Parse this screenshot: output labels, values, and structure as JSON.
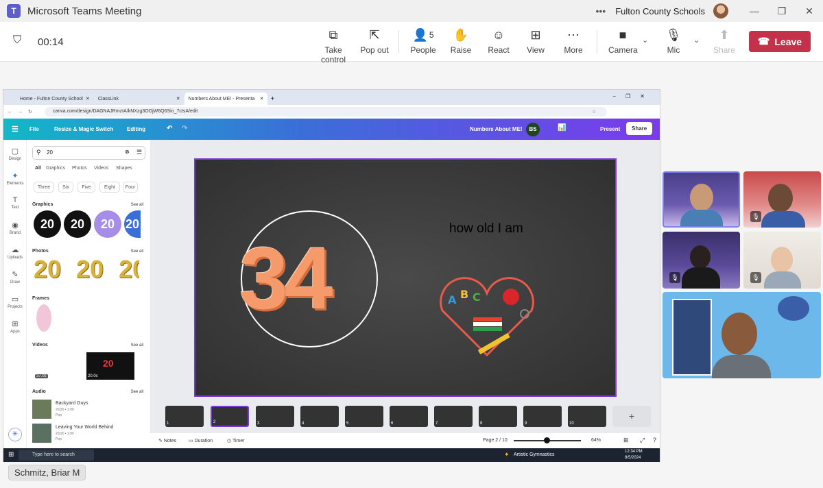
{
  "app": {
    "title": "Microsoft Teams Meeting",
    "org": "Fulton County Schools"
  },
  "meeting": {
    "timer": "00:14",
    "people_count": "5"
  },
  "toolbar": {
    "take_control": "Take control",
    "pop_out": "Pop out",
    "people": "People",
    "raise": "Raise",
    "react": "React",
    "view": "View",
    "more": "More",
    "camera": "Camera",
    "mic": "Mic",
    "share": "Share",
    "leave": "Leave"
  },
  "browser": {
    "tabs": [
      "Home - Fulton County School",
      "ClassLink",
      "Numbers About ME! - Presenta"
    ],
    "url": "canva.com/design/DAGNAJRmztA/kNXzg3OOjW6Q6Sio_7ctsA/edit"
  },
  "canva": {
    "file": "File",
    "resize": "Resize & Magic Switch",
    "editing": "Editing",
    "design_title": "Numbers About ME!",
    "avatar_initials": "BS",
    "present": "Present",
    "share": "Share",
    "rail": [
      "Design",
      "Elements",
      "Text",
      "Brand",
      "Uploads",
      "Draw",
      "Projects",
      "Apps"
    ],
    "search_value": "20",
    "panel_tabs": [
      "All",
      "Graphics",
      "Photos",
      "Videos",
      "Shapes"
    ],
    "pills": [
      "Three",
      "Six",
      "Five",
      "Eight",
      "Four"
    ],
    "sections": {
      "graphics": "Graphics",
      "photos": "Photos",
      "frames": "Frames",
      "videos": "Videos",
      "audio": "Audio"
    },
    "see_all": "See all",
    "graphic_text": "20",
    "video_durations": [
      "37.0s",
      "20.0s"
    ],
    "audio": [
      {
        "title": "Backyard Guys",
        "meta": "20/20 • 1:00",
        "genre": "Pop"
      },
      {
        "title": "Leaving Your World Behind",
        "meta": "20/20 • 1:00",
        "genre": "Pop"
      }
    ],
    "slide": {
      "number_text": "34",
      "caption": "how old I am"
    },
    "thumb_numbers": [
      "1",
      "2",
      "3",
      "4",
      "5",
      "6",
      "7",
      "8",
      "9",
      "10"
    ],
    "status": {
      "notes": "Notes",
      "duration": "Duration",
      "timer": "Timer",
      "page": "Page 2 / 10",
      "zoom": "64%"
    }
  },
  "taskbar": {
    "search": "Type here to search",
    "weather": "Artistic Gymnastics",
    "time": "12:34 PM",
    "date": "8/5/2024"
  },
  "participant": {
    "name": "Schmitz, Briar M"
  }
}
